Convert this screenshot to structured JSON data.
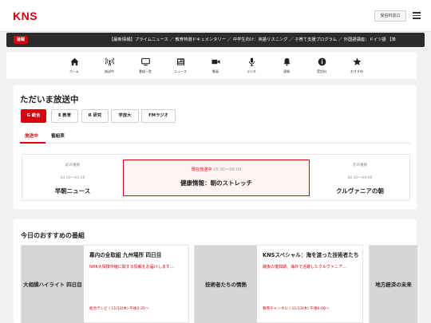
{
  "header": {
    "logo": "KNS",
    "fee_button": "受信料窓口"
  },
  "ticker": {
    "badge": "速報",
    "text": "【最新情報】プライムニュース ／ 教育特選ドキュメンタリー ／ 中学生向け：英語リスニング ／ 子育て支援プログラム ／ 外国語講座：ドイツ語 【単"
  },
  "nav": {
    "items": [
      {
        "label": "ホーム",
        "icon": "home-icon"
      },
      {
        "label": "放送中",
        "icon": "broadcast-icon"
      },
      {
        "label": "番組一覧",
        "icon": "tv-icon"
      },
      {
        "label": "ニュース",
        "icon": "newspaper-icon"
      },
      {
        "label": "動画",
        "icon": "video-icon"
      },
      {
        "label": "ラジオ",
        "icon": "microphone-icon"
      },
      {
        "label": "速報",
        "icon": "bell-icon"
      },
      {
        "label": "受信料",
        "icon": "info-icon"
      },
      {
        "label": "おすすめ",
        "icon": "star-icon"
      }
    ]
  },
  "onair": {
    "title": "ただいま放送中",
    "channels": [
      "G 総合",
      "E 教育",
      "R 研究",
      "学放大",
      "FMラジオ"
    ],
    "tabs": [
      "放送中",
      "番組表"
    ],
    "previous": {
      "kind": "前の番組",
      "time": "04:00〜05:00",
      "title": "早朝ニュース"
    },
    "current": {
      "status": "現在放送中",
      "time": "05:00〜06:00",
      "title": "健康情報：朝のストレッチ"
    },
    "next": {
      "kind": "次の番組",
      "time": "06:00〜09:00",
      "title": "クルヴァニアの朝"
    }
  },
  "recommend": {
    "title": "今日のおすすめの番組",
    "cards": [
      {
        "thumb": "大相撲ハイライト 四日目",
        "title": "幕内の全取組 九州場所 四日目",
        "desc": "NHK大相撲中継に関する情報をお届けします…",
        "meta": "総合テレビ / 11/13(木) 午後3:35〜"
      },
      {
        "thumb": "技術者たちの情熱",
        "title": "KNSスペシャル：海を渡った技術者たち",
        "desc": "戦後の復興期、海外で活躍したクルヴァニア…",
        "meta": "教育チャンネル / 11/13(木) 午後6:00〜"
      },
      {
        "thumb": "地方経済の未来"
      }
    ]
  },
  "colors": {
    "accent": "#d7000f",
    "background": "#f2f2f2",
    "ticker_bg": "#2b2b2b"
  }
}
